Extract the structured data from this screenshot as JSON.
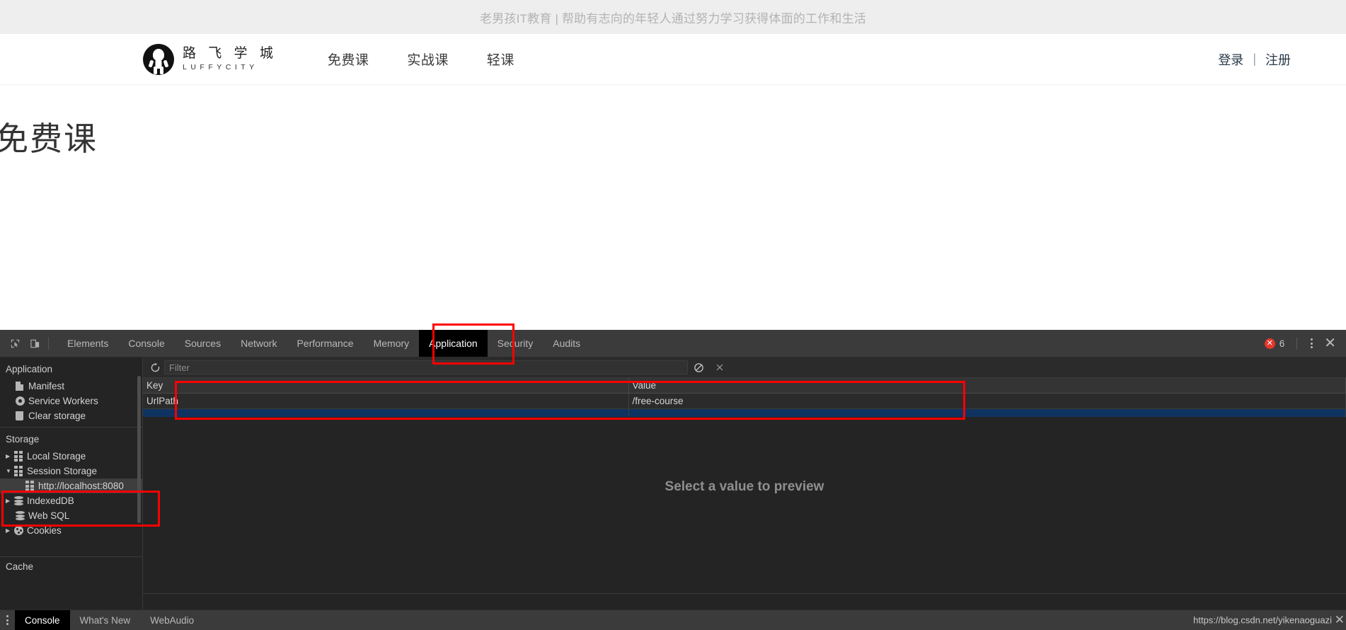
{
  "site": {
    "topbar_text": "老男孩IT教育 | 帮助有志向的年轻人通过努力学习获得体面的工作和生活",
    "logo_cn": "路 飞 学 城",
    "logo_en": "LUFFYCITY",
    "nav": [
      {
        "label": "免费课"
      },
      {
        "label": "实战课"
      },
      {
        "label": "轻课"
      }
    ],
    "auth": {
      "login": "登录",
      "separator": "|",
      "register": "注册"
    },
    "page_title": "免费课"
  },
  "devtools": {
    "toolbar": {
      "inspect_icon": "inspect-element-icon",
      "device_icon": "device-toolbar-icon",
      "tabs": [
        {
          "label": "Elements",
          "active": false
        },
        {
          "label": "Console",
          "active": false
        },
        {
          "label": "Sources",
          "active": false
        },
        {
          "label": "Network",
          "active": false
        },
        {
          "label": "Performance",
          "active": false
        },
        {
          "label": "Memory",
          "active": false
        },
        {
          "label": "Application",
          "active": true
        },
        {
          "label": "Security",
          "active": false
        },
        {
          "label": "Audits",
          "active": false
        }
      ],
      "error_icon": "error-circle-icon",
      "error_count": "6",
      "menu_icon": "kebab-menu-icon",
      "close_icon": "close-icon"
    },
    "sidebar": {
      "sections": [
        {
          "title": "Application",
          "items": [
            {
              "label": "Manifest",
              "icon": "document-icon",
              "arrow": "",
              "indent": 1,
              "selected": false
            },
            {
              "label": "Service Workers",
              "icon": "gear-icon",
              "arrow": "",
              "indent": 1,
              "selected": false
            },
            {
              "label": "Clear storage",
              "icon": "trash-icon",
              "arrow": "",
              "indent": 1,
              "selected": false
            }
          ]
        },
        {
          "title": "Storage",
          "items": [
            {
              "label": "Local Storage",
              "icon": "grid-icon",
              "arrow": "▶",
              "indent": 0,
              "selected": false
            },
            {
              "label": "Session Storage",
              "icon": "grid-icon",
              "arrow": "▼",
              "indent": 0,
              "selected": false
            },
            {
              "label": "http://localhost:8080",
              "icon": "grid-icon",
              "arrow": "",
              "indent": 2,
              "selected": true
            },
            {
              "label": "IndexedDB",
              "icon": "database-icon",
              "arrow": "▶",
              "indent": 0,
              "selected": false
            },
            {
              "label": "Web SQL",
              "icon": "database-icon",
              "arrow": "",
              "indent": 1,
              "selected": false
            },
            {
              "label": "Cookies",
              "icon": "cookie-icon",
              "arrow": "▶",
              "indent": 0,
              "selected": false
            }
          ]
        },
        {
          "title": "Cache",
          "items": []
        }
      ]
    },
    "filterbar": {
      "refresh_icon": "refresh-icon",
      "filter_placeholder": "Filter",
      "filter_value": "",
      "clear_icon": "clear-all-icon",
      "delete_icon": "delete-selected-icon"
    },
    "storage_table": {
      "columns": [
        "Key",
        "Value"
      ],
      "rows": [
        {
          "key": "UrlPath",
          "value": "/free-course"
        }
      ]
    },
    "preview": {
      "empty_text": "Select a value to preview"
    },
    "drawer": {
      "menu_icon": "kebab-menu-icon",
      "tabs": [
        {
          "label": "Console",
          "active": true
        },
        {
          "label": "What's New",
          "active": false
        },
        {
          "label": "WebAudio",
          "active": false
        }
      ],
      "close_icon": "close-icon"
    },
    "status_url": "https://blog.csdn.net/yikenaoguazi"
  },
  "annotations": {
    "accent_color": "#fe0000",
    "boxes": [
      {
        "name": "application-tab-highlight"
      },
      {
        "name": "storage-table-highlight"
      },
      {
        "name": "session-storage-highlight"
      }
    ]
  }
}
